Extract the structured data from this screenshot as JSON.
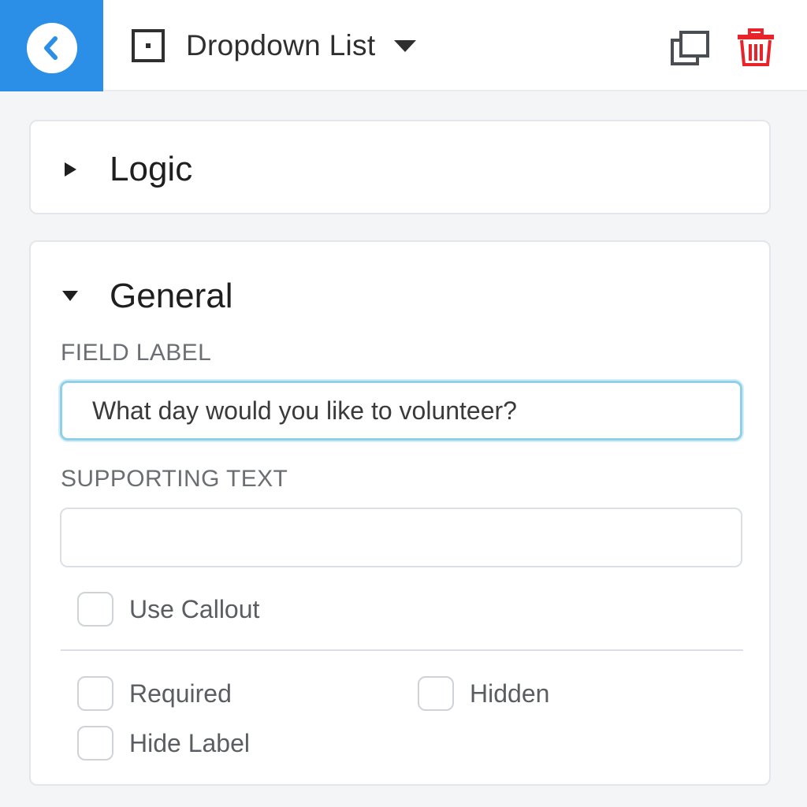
{
  "header": {
    "field_type_label": "Dropdown List",
    "back_color": "#2b8fe8",
    "delete_color": "#e8232a"
  },
  "sections": {
    "logic": {
      "title": "Logic",
      "expanded": false
    },
    "general": {
      "title": "General",
      "expanded": true
    }
  },
  "general": {
    "field_label_caption": "FIELD LABEL",
    "field_label_value": "What day would you like to volunteer?",
    "supporting_text_caption": "SUPPORTING TEXT",
    "supporting_text_value": "",
    "use_callout_label": "Use Callout",
    "required_label": "Required",
    "hidden_label": "Hidden",
    "hide_label_label": "Hide Label"
  },
  "icons": {
    "back": "chevron-left-icon",
    "field_type": "dropdown-field-icon",
    "caret": "caret-down-icon",
    "duplicate": "duplicate-icon",
    "delete": "trash-icon",
    "collapsed": "triangle-right-icon",
    "expanded": "triangle-down-icon"
  }
}
